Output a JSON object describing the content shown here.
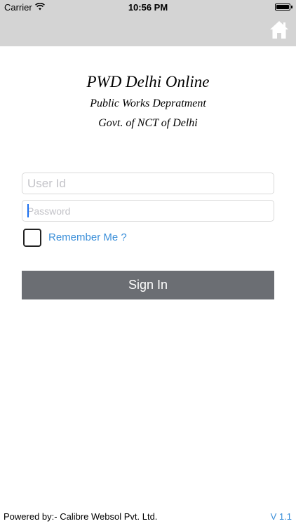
{
  "status_bar": {
    "carrier": "Carrier",
    "time": "10:56 PM"
  },
  "nav": {
    "home_icon": "home-icon"
  },
  "header": {
    "title": "PWD Delhi Online",
    "subtitle1": "Public Works Depratment",
    "subtitle2": "Govt. of NCT of Delhi"
  },
  "form": {
    "user_placeholder": "User Id",
    "user_value": "",
    "password_placeholder": "Password",
    "password_value": "",
    "remember_label": "Remember Me ?",
    "remember_checked": false,
    "signin_label": "Sign In"
  },
  "footer": {
    "powered_by": "Powered by:- Calibre Websol Pvt. Ltd.",
    "version": "V 1.1"
  },
  "colors": {
    "bar": "#d4d4d4",
    "button": "#6b6e73",
    "link": "#3b8fd9"
  }
}
